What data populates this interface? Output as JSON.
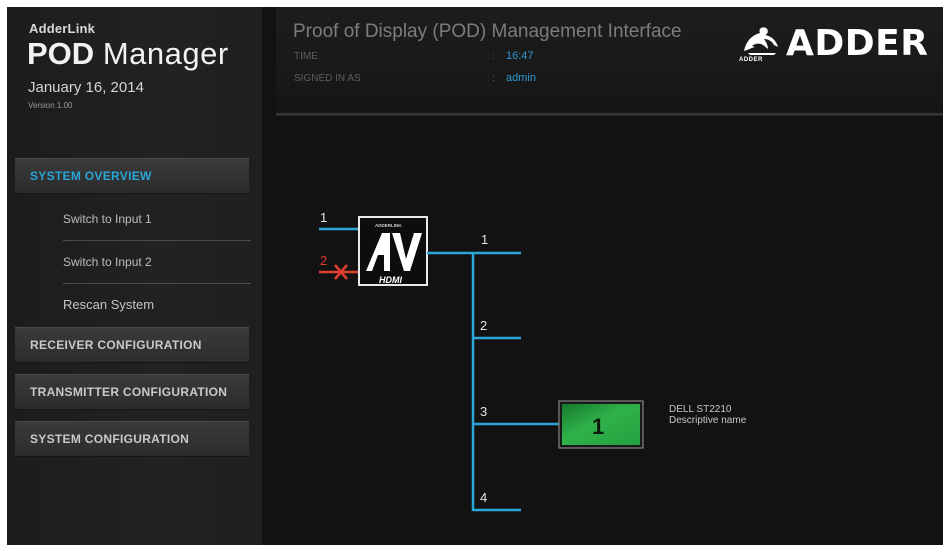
{
  "sidebar": {
    "brand_small": "AdderLink",
    "brand_bold": "POD",
    "brand_light": "Manager",
    "date": "January 16, 2014",
    "version": "Version 1.00",
    "system_overview": "SYSTEM OVERVIEW",
    "sub_items": [
      {
        "label": "Switch to Input 1"
      },
      {
        "label": "Switch to Input 2"
      },
      {
        "label": "Rescan System"
      }
    ],
    "receiver_configuration": "RECEIVER CONFIGURATION",
    "transmitter_configuration": "TRANSMITTER CONFIGURATION",
    "system_configuration": "SYSTEM CONFIGURATION"
  },
  "header": {
    "title": "Proof of Display (POD) Management Interface",
    "time_label": "TIME",
    "time_value": "16:47",
    "signed_in_label": "SIGNED IN AS",
    "signed_in_value": "admin",
    "colon": ":",
    "logo_text": "ADDER",
    "logo_sub": "ADDER"
  },
  "diagram": {
    "device_brand": "ADDERLINK",
    "device_label": "HDMI",
    "inputs": [
      {
        "label": "1",
        "status": "connected",
        "color": "#2aa7d6"
      },
      {
        "label": "2",
        "status": "disconnected",
        "color": "#e0412e"
      }
    ],
    "outputs": [
      {
        "label": "1"
      },
      {
        "label": "2"
      },
      {
        "label": "3"
      },
      {
        "label": "4"
      }
    ],
    "display": {
      "number": "1",
      "model": "DELL ST2210",
      "description": "Descriptive name",
      "color": "#2fb14a"
    }
  },
  "colors": {
    "accent": "#29a6d8",
    "line": "#2aa7d6",
    "error": "#e0412e"
  }
}
